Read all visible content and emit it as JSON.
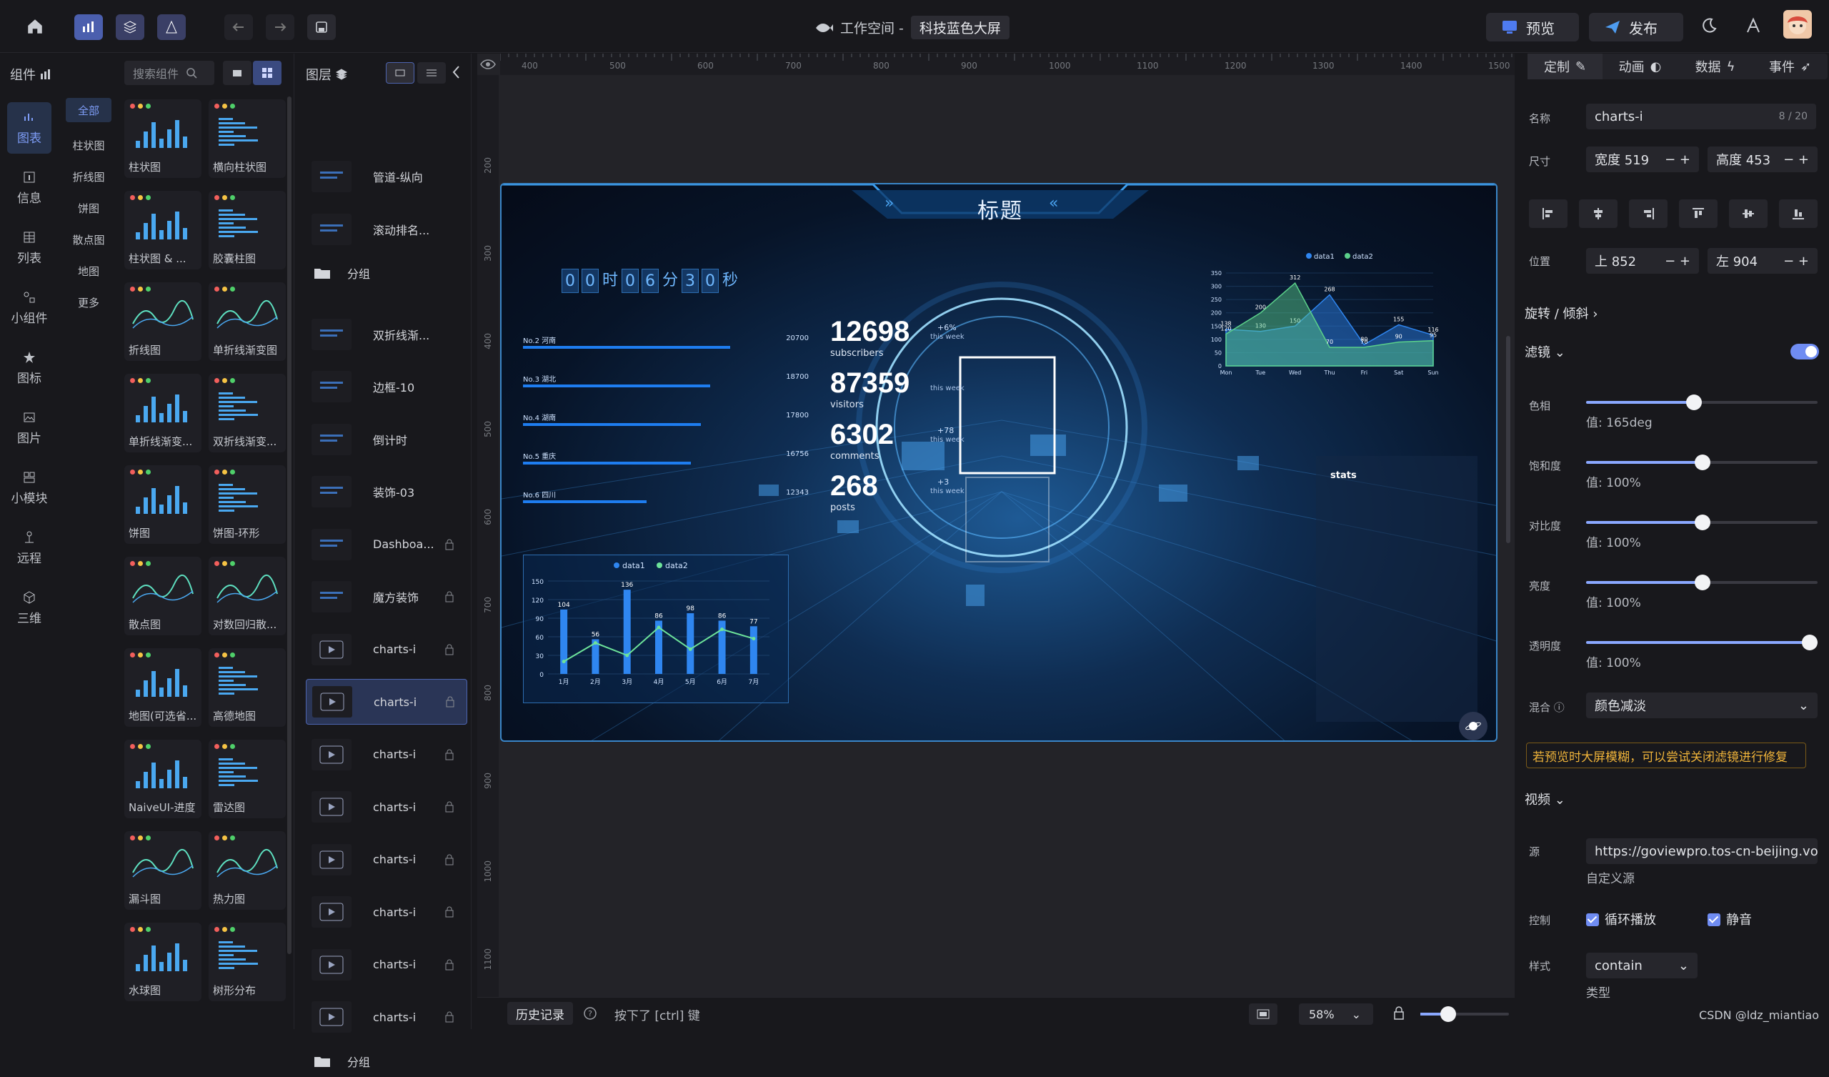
{
  "topbar": {
    "workspace": "工作空间 -",
    "project": "科技蓝色大屏",
    "preview": "预览",
    "publish": "发布"
  },
  "left": {
    "components_title": "组件",
    "search_placeholder": "搜索组件",
    "categories": [
      {
        "label": "图表",
        "icon": "chart-icon"
      },
      {
        "label": "信息",
        "icon": "info-icon"
      },
      {
        "label": "列表",
        "icon": "table-icon"
      },
      {
        "label": "小组件",
        "icon": "widget-icon"
      },
      {
        "label": "图标",
        "icon": "star-icon"
      },
      {
        "label": "图片",
        "icon": "image-icon"
      },
      {
        "label": "小模块",
        "icon": "module-icon"
      },
      {
        "label": "远程",
        "icon": "remote-icon"
      },
      {
        "label": "三维",
        "icon": "cube-icon"
      }
    ],
    "subcats": [
      "全部",
      "柱状图",
      "折线图",
      "饼图",
      "散点图",
      "地图",
      "更多"
    ],
    "cards": [
      "柱状图",
      "横向柱状图",
      "柱状图 & ...",
      "胶囊柱图",
      "折线图",
      "单折线渐变图",
      "单折线渐变...",
      "双折线渐变...",
      "饼图",
      "饼图-环形",
      "散点图",
      "对数回归散...",
      "地图(可选省...",
      "高德地图",
      "NaiveUI-进度",
      "雷达图",
      "漏斗图",
      "热力图",
      "水球图",
      "树形分布"
    ]
  },
  "layers": {
    "title": "图层",
    "items": [
      "管道-纵向",
      "滚动排名...",
      "分组",
      "双折线渐...",
      "边框-10",
      "倒计时",
      "装饰-03",
      "Dashboa...",
      "魔方装饰",
      "charts-i",
      "charts-i",
      "charts-i",
      "charts-i",
      "charts-i",
      "charts-i",
      "charts-i",
      "charts-i",
      "分组"
    ]
  },
  "canvas": {
    "title": "标题",
    "countdown": [
      "0",
      "0",
      "时",
      "0",
      "6",
      "分",
      "3",
      "0",
      "秒"
    ],
    "ranking": [
      {
        "label": "No.2 河南",
        "value": "20700"
      },
      {
        "label": "No.3 湖北",
        "value": "18700"
      },
      {
        "label": "No.4 湖南",
        "value": "17800"
      },
      {
        "label": "No.5 重庆",
        "value": "16756"
      },
      {
        "label": "No.6 四川",
        "value": "12343"
      }
    ],
    "stats_title": "stats",
    "stats": [
      {
        "num": "12698",
        "label": "subscribers",
        "delta": "+6%",
        "week": "this week"
      },
      {
        "num": "87359",
        "label": "visitors",
        "delta": "",
        "week": "this week"
      },
      {
        "num": "6302",
        "label": "comments",
        "delta": "+78",
        "week": "this week"
      },
      {
        "num": "268",
        "label": "posts",
        "delta": "+3",
        "week": "this week"
      }
    ],
    "ruler_top": [
      "400",
      "500",
      "600",
      "700",
      "800",
      "900",
      "1000",
      "1100",
      "1200",
      "1300",
      "1400",
      "1500"
    ],
    "ruler_left": [
      "200",
      "300",
      "400",
      "500",
      "600",
      "700",
      "800",
      "900",
      "1000",
      "1100"
    ]
  },
  "bottom": {
    "history": "历史记录",
    "hint": "按下了 [ctrl] 键",
    "zoom": "58%"
  },
  "right": {
    "tabs": [
      "定制",
      "动画",
      "数据",
      "事件"
    ],
    "name_label": "名称",
    "name_value": "charts-i",
    "name_count": "8 / 20",
    "size_label": "尺寸",
    "width": "宽度 519",
    "height": "高度 453",
    "pos_label": "位置",
    "top": "上 852",
    "left": "左 904",
    "rotate": "旋转 / 倾斜",
    "filter": "滤镜",
    "hue": "色相",
    "hue_val": "值: 165deg",
    "sat": "饱和度",
    "sat_val": "值: 100%",
    "contrast": "对比度",
    "contrast_val": "值: 100%",
    "bright": "亮度",
    "bright_val": "值: 100%",
    "opacity": "透明度",
    "opacity_val": "值: 100%",
    "blend": "混合",
    "blend_val": "颜色减淡",
    "warn": "若预览时大屏模糊，可以尝试关闭滤镜进行修复",
    "video": "视频",
    "src_label": "源",
    "src": "https://goviewpro.tos-cn-beijing.vol",
    "custom_src": "自定义源",
    "ctrl_label": "控制",
    "loop": "循环播放",
    "mute": "静音",
    "style_label": "样式",
    "style_val": "contain",
    "type_label": "类型"
  },
  "watermark": "CSDN @ldz_miantiao",
  "chart_data": [
    {
      "type": "bar",
      "legend": [
        "data1",
        "data2"
      ],
      "categories": [
        "1月",
        "2月",
        "3月",
        "4月",
        "5月",
        "6月",
        "7月"
      ],
      "series": [
        {
          "name": "data1",
          "values": [
            104,
            56,
            136,
            86,
            98,
            86,
            77
          ]
        },
        {
          "name": "data2",
          "values": [
            20,
            50,
            30,
            75,
            40,
            72,
            57
          ]
        }
      ],
      "ylim": [
        0,
        150
      ],
      "yticks": [
        "150",
        "120",
        "90",
        "60",
        "30",
        "0"
      ]
    },
    {
      "type": "area",
      "legend": [
        "data1",
        "data2"
      ],
      "categories": [
        "Mon",
        "Tue",
        "Wed",
        "Thu",
        "Fri",
        "Sat",
        "Sun"
      ],
      "series": [
        {
          "name": "data1",
          "values": [
            138,
            130,
            150,
            268,
            80,
            155,
            116
          ]
        },
        {
          "name": "data2",
          "values": [
            120,
            200,
            312,
            70,
            70,
            90,
            95
          ]
        }
      ],
      "ylim": [
        0,
        350
      ],
      "yticks": [
        "350",
        "300",
        "250",
        "200",
        "150",
        "100",
        "50",
        "0"
      ]
    }
  ]
}
